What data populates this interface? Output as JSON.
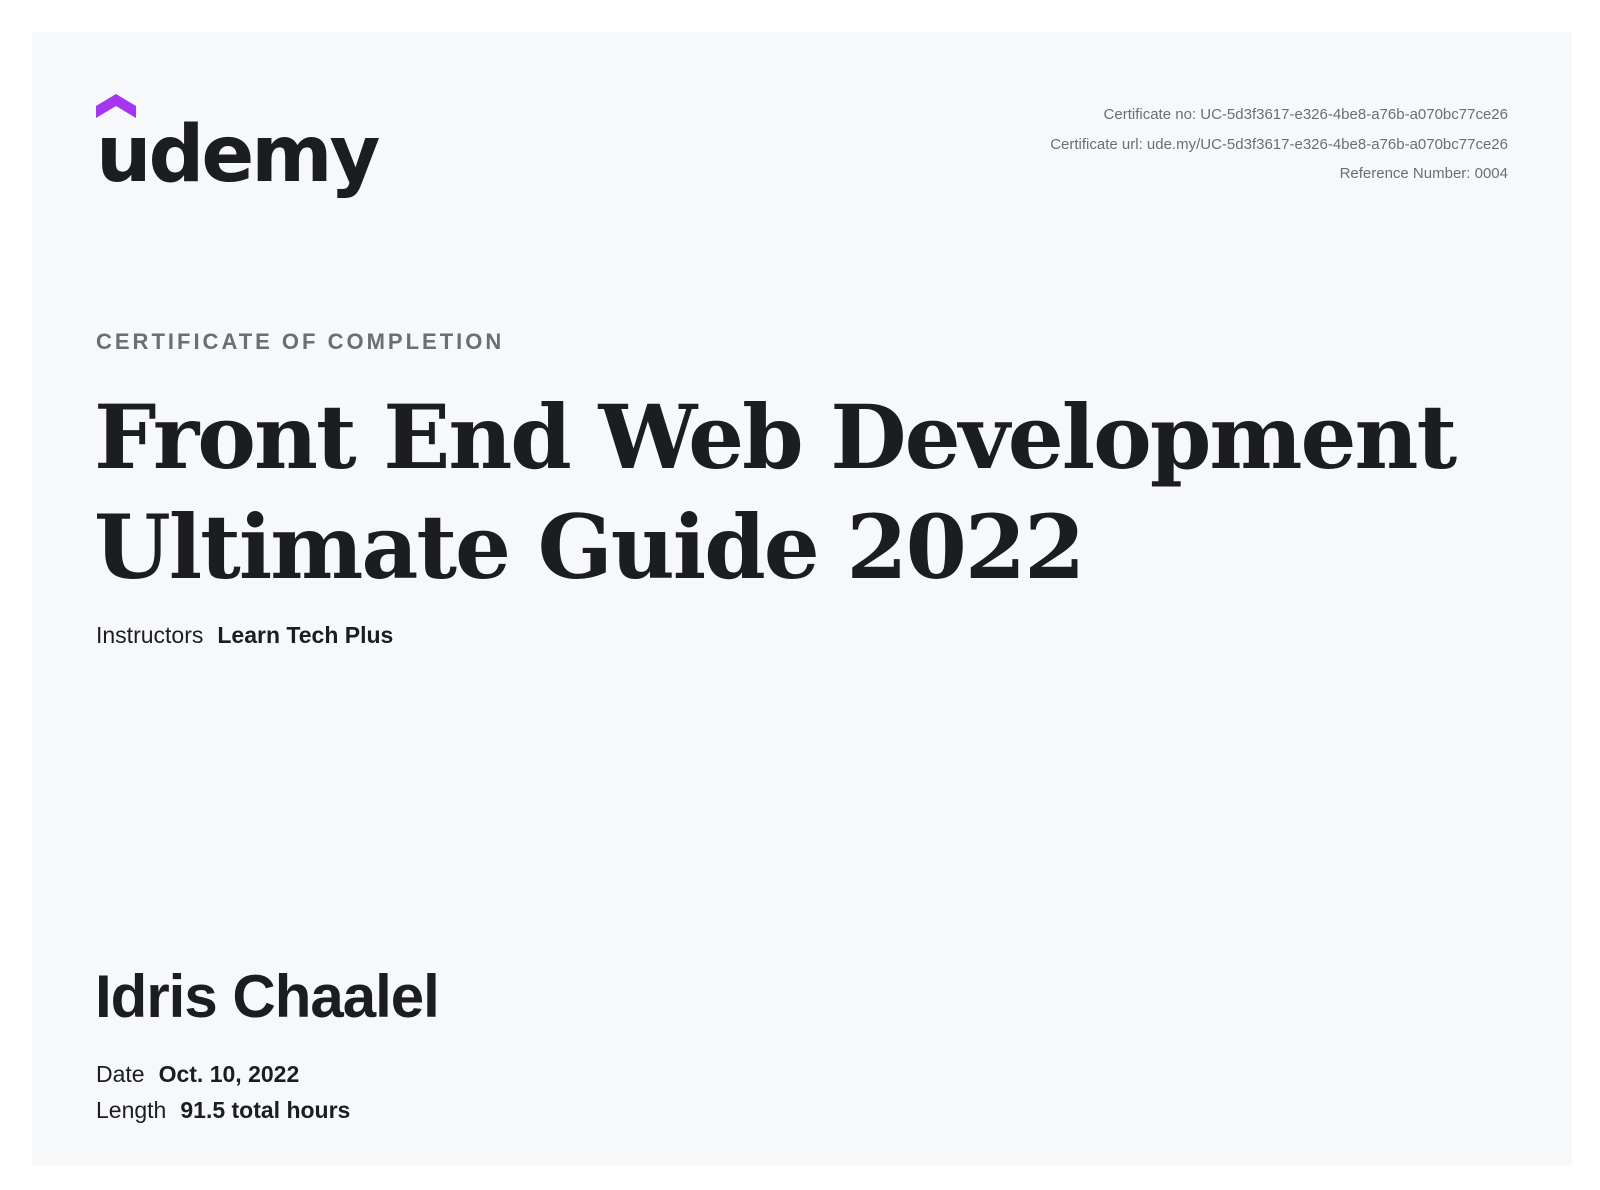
{
  "brand": {
    "name": "udemy",
    "accent_color": "#a435f0",
    "text_color": "#1c1d1f"
  },
  "meta": {
    "certificate_no": "Certificate no: UC-5d3f3617-e326-4be8-a76b-a070bc77ce26",
    "certificate_url": "Certificate url: ude.my/UC-5d3f3617-e326-4be8-a76b-a070bc77ce26",
    "reference_number": "Reference Number: 0004"
  },
  "certificate": {
    "kicker": "CERTIFICATE OF COMPLETION",
    "course_title_line1": "Front End Web Development",
    "course_title_line2": "Ultimate Guide 2022",
    "instructors_label": "Instructors",
    "instructors_value": "Learn Tech Plus",
    "recipient_name": "Idris Chaalel",
    "date_label": "Date",
    "date_value": "Oct. 10, 2022",
    "length_label": "Length",
    "length_value": "91.5 total hours"
  },
  "colors": {
    "background": "#f7f8fa",
    "muted_text": "#6a6f73"
  }
}
